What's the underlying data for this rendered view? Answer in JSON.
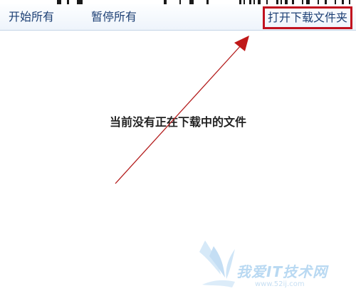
{
  "toolbar": {
    "start_all": "开始所有",
    "pause_all": "暂停所有",
    "open_folder": "打开下载文件夹"
  },
  "main": {
    "empty_message": "当前没有正在下载中的文件"
  },
  "annotation": {
    "arrow_color": "#b31b1b",
    "highlight_color": "#c1121f"
  },
  "watermark": {
    "brand": "我爱IT技术网",
    "url": "www.52ij.com"
  }
}
